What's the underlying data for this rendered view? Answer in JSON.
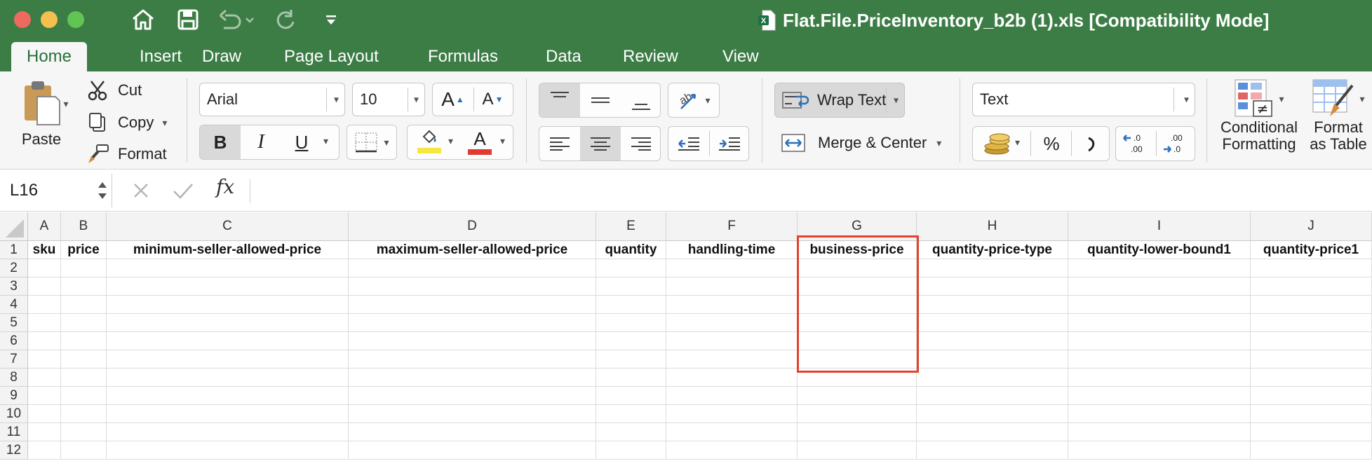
{
  "window": {
    "title": "Flat.File.PriceInventory_b2b (1).xls  [Compatibility Mode]",
    "traffic_colors": [
      "#ed6a5e",
      "#f5bf4f",
      "#61c554"
    ],
    "quick_access": [
      "home-icon",
      "save-icon",
      "undo-icon",
      "redo-icon",
      "customize-icon"
    ]
  },
  "tabs": [
    "Home",
    "Insert",
    "Draw",
    "Page Layout",
    "Formulas",
    "Data",
    "Review",
    "View"
  ],
  "active_tab": "Home",
  "clipboard": {
    "paste": "Paste",
    "cut": "Cut",
    "copy": "Copy",
    "format": "Format"
  },
  "font": {
    "name": "Arial",
    "size": "10",
    "increase": "A",
    "decrease": "A",
    "bold": "B",
    "italic": "I",
    "underline": "U",
    "color_letter": "A",
    "fill_color": "#f5e642",
    "font_color": "#e03b2e"
  },
  "alignment": {
    "wrap_text": "Wrap Text",
    "merge_center": "Merge & Center"
  },
  "number": {
    "format": "Text",
    "percent": "%",
    "comma": "ʔ",
    "inc_decimal": ".0\n.00",
    "dec_decimal": ".00\n.0"
  },
  "styles": {
    "conditional_1": "Conditional",
    "conditional_2": "Formatting",
    "format_table_1": "Format",
    "format_table_2": "as Table"
  },
  "formula_bar": {
    "name_box": "L16",
    "fx": "fx",
    "content": ""
  },
  "sheet": {
    "columns": [
      "A",
      "B",
      "C",
      "D",
      "E",
      "F",
      "G",
      "H",
      "I",
      "J"
    ],
    "rows": [
      "1",
      "2",
      "3",
      "4",
      "5",
      "6",
      "7",
      "8",
      "9",
      "10",
      "11",
      "12"
    ],
    "header_row": [
      "sku",
      "price",
      "minimum-seller-allowed-price",
      "maximum-seller-allowed-price",
      "quantity",
      "handling-time",
      "business-price",
      "quantity-price-type",
      "quantity-lower-bound1",
      "quantity-price1"
    ],
    "highlight_color": "#e5412d"
  }
}
